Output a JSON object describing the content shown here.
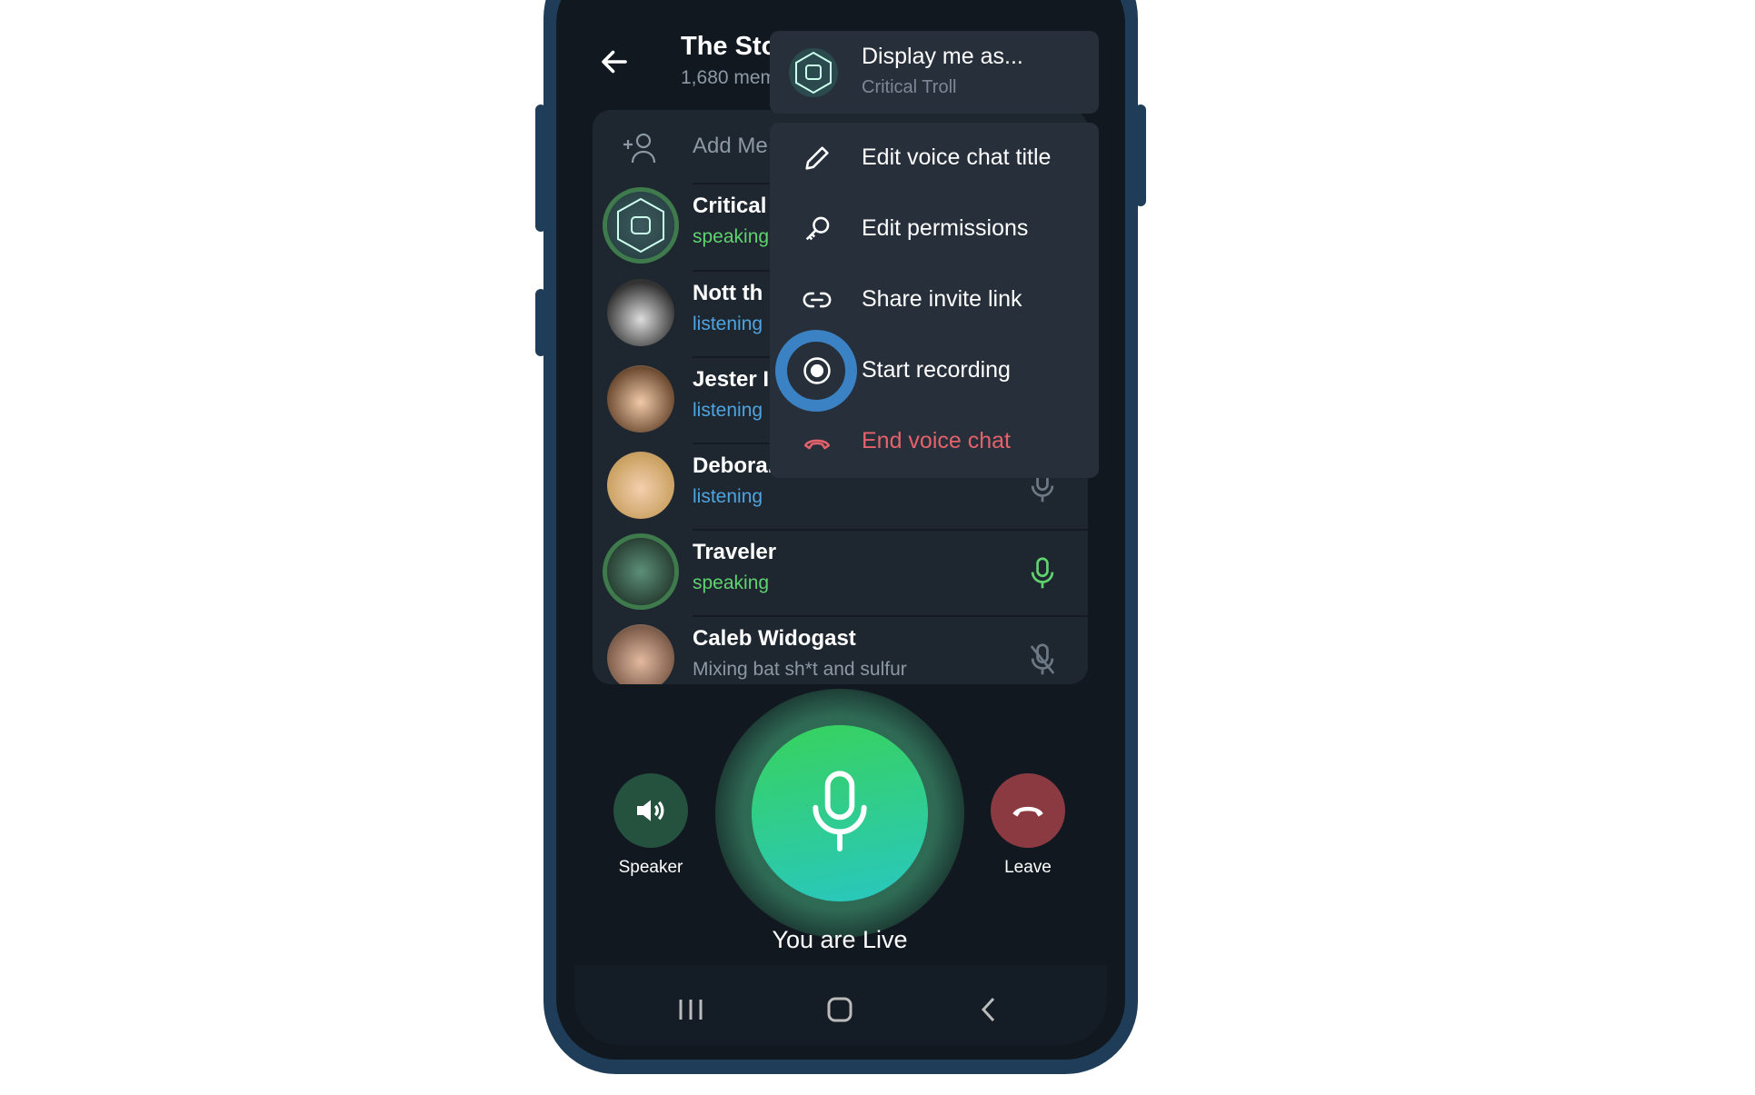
{
  "header": {
    "title": "The Sto",
    "subtitle": "1,680 mem"
  },
  "panel": {
    "add_member_label": "Add Me",
    "participants": [
      {
        "name": "Critical",
        "status": "speaking",
        "state": "speaking"
      },
      {
        "name": "Nott th",
        "status": "listening",
        "state": "listening"
      },
      {
        "name": "Jester I",
        "status": "listening",
        "state": "listening"
      },
      {
        "name": "Debora..",
        "status": "listening",
        "state": "listening"
      },
      {
        "name": "Traveler",
        "status": "speaking",
        "state": "speaking"
      },
      {
        "name": "Caleb Widogast",
        "status": "Mixing bat sh*t and sulfur",
        "state": "muted"
      }
    ]
  },
  "menu": {
    "display_as": {
      "label": "Display me as...",
      "value": "Critical Troll"
    },
    "items": [
      {
        "label": "Edit voice chat title",
        "icon": "pencil-icon"
      },
      {
        "label": "Edit permissions",
        "icon": "key-icon"
      },
      {
        "label": "Share invite link",
        "icon": "link-icon"
      },
      {
        "label": "Start recording",
        "icon": "record-icon"
      },
      {
        "label": "End voice chat",
        "icon": "hangup-icon"
      }
    ]
  },
  "controls": {
    "speaker_label": "Speaker",
    "leave_label": "Leave",
    "live_label": "You are Live"
  },
  "colors": {
    "speaking": "#5fd36e",
    "listening": "#4ea4e0",
    "danger": "#e5616b",
    "mic_gradient_top": "#38d25c",
    "mic_gradient_bottom": "#28c7c0",
    "leave": "#8b3a42",
    "highlight": "#3b82c4"
  }
}
